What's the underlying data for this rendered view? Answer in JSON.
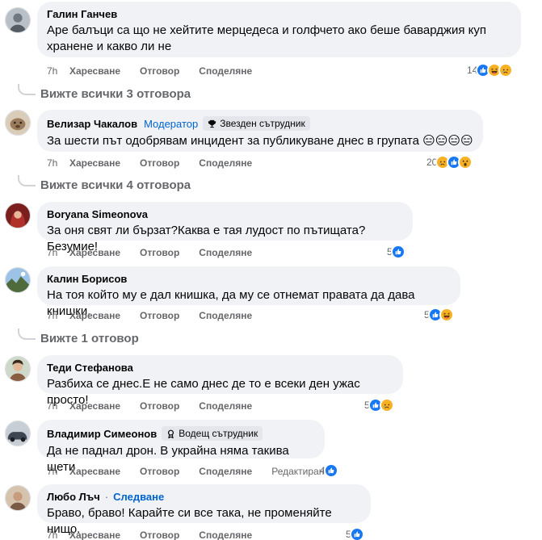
{
  "comments": [
    {
      "author": "Галин Ганчев",
      "text": "Аре балъци са що не хейтите мерцедеса и голфчето ако беше баварджия куп хранене и какво ли не",
      "time": "7h",
      "like": "Харесване",
      "reply": "Отговор",
      "share": "Споделяне",
      "reaction_count": "14",
      "reactions": [
        "like",
        "haha",
        "sad"
      ],
      "replies_label": "Вижте всички 3 отговора"
    },
    {
      "author": "Велизар Чакалов",
      "moderator": "Модератор",
      "badge": "Звезден сътрудник",
      "text": "За шести път одобрявам инцидент за публикуване днес в групата 😑😑😑😑",
      "time": "7h",
      "like": "Харесване",
      "reply": "Отговор",
      "share": "Споделяне",
      "reaction_count": "20",
      "reactions": [
        "sad",
        "like",
        "wow"
      ],
      "replies_label": "Вижте всички 4 отговора"
    },
    {
      "author": "Boryana Simeonova",
      "text": "За оня свят ли бързат?Каква е тая лудост по пътищата?Безумие!",
      "time": "7h",
      "like": "Харесване",
      "reply": "Отговор",
      "share": "Споделяне",
      "reaction_count": "5",
      "reactions": [
        "like"
      ]
    },
    {
      "author": "Калин Борисов",
      "text": "На тоя който му е дал книшка, да му се отнемат правата да дава книшки.",
      "time": "7h",
      "like": "Харесване",
      "reply": "Отговор",
      "share": "Споделяне",
      "reaction_count": "5",
      "reactions": [
        "like",
        "haha"
      ],
      "replies_label": "Вижте 1 отговор"
    },
    {
      "author": "Теди Стефанова",
      "text": "Разбиха се днес.Е не само днес де то е всеки ден ужас просто!",
      "time": "7h",
      "like": "Харесване",
      "reply": "Отговор",
      "share": "Споделяне",
      "reaction_count": "5",
      "reactions": [
        "like",
        "sad"
      ]
    },
    {
      "author": "Владимир Симеонов",
      "badge": "Водещ сътрудник",
      "text": "Да не паднал дрон. В украйна няма такива щети",
      "time": "7h",
      "like": "Харесване",
      "reply": "Отговор",
      "share": "Споделяне",
      "edited": "Редактирано",
      "reaction_count": "4",
      "reactions": [
        "like"
      ]
    },
    {
      "author": "Любо Лъч",
      "follow": "Следване",
      "text": "Браво, браво! Карайте си все така, не променяйте нищо.",
      "time": "7h",
      "like": "Харесване",
      "reply": "Отговор",
      "share": "Споделяне",
      "reaction_count": "5",
      "reactions": [
        "like"
      ]
    }
  ],
  "colors": {
    "bubble": "#f0f2f5",
    "link_blue": "#0064d1",
    "meta_gray": "#65676b",
    "like_blue": "#1877f2",
    "emoji_yellow": "#f7b125"
  }
}
